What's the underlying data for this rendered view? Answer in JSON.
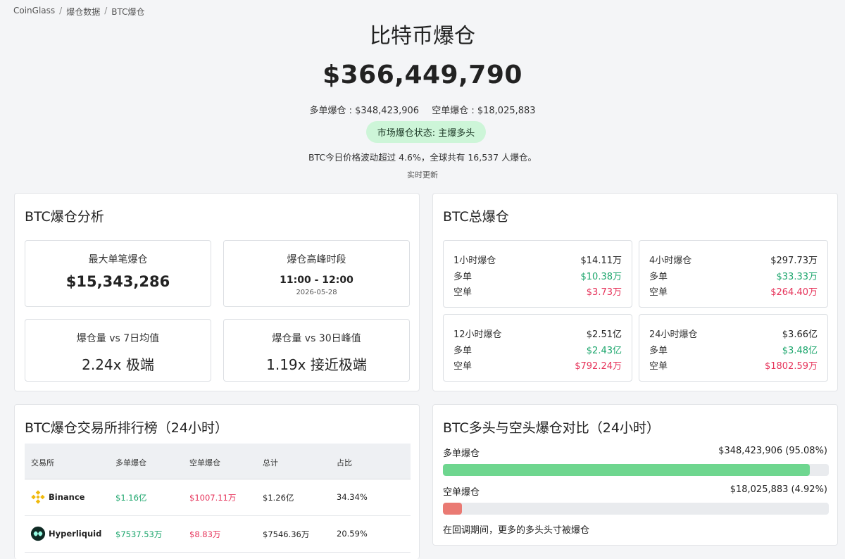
{
  "breadcrumb": [
    "CoinGlass",
    "爆仓数据",
    "BTC爆仓"
  ],
  "hero": {
    "title": "比特币爆仓",
    "amount": "$366,449,790",
    "long_text": "多单爆仓 : $348,423,906",
    "short_text": "空单爆仓 : $18,025,883",
    "status": "市场爆仓状态: 主爆多头",
    "desc": "BTC今日价格波动超过 4.6%，全球共有 16,537 人爆仓。",
    "live": "实时更新"
  },
  "analysis": {
    "title": "BTC爆仓分析",
    "max_label": "最大单笔爆仓",
    "max_value": "$15,343,286",
    "peak_label": "爆仓高峰时段",
    "peak_value": "11:00 - 12:00",
    "peak_date": "2026-05-28",
    "vs7_label": "爆仓量 vs 7日均值",
    "vs7_value": "2.24x 极端",
    "vs30_label": "爆仓量 vs 30日峰值",
    "vs30_value": "1.19x 接近极端"
  },
  "total": {
    "title": "BTC总爆仓",
    "long_label": "多单",
    "short_label": "空单",
    "boxes": [
      {
        "label": "1小时爆仓",
        "total": "$14.11万",
        "long": "$10.38万",
        "short": "$3.73万"
      },
      {
        "label": "4小时爆仓",
        "total": "$297.73万",
        "long": "$33.33万",
        "short": "$264.40万"
      },
      {
        "label": "12小时爆仓",
        "total": "$2.51亿",
        "long": "$2.43亿",
        "short": "$792.24万"
      },
      {
        "label": "24小时爆仓",
        "total": "$3.66亿",
        "long": "$3.48亿",
        "short": "$1802.59万"
      }
    ]
  },
  "ranking": {
    "title": "BTC爆仓交易所排行榜（24小时）",
    "headers": [
      "交易所",
      "多单爆仓",
      "空单爆仓",
      "总计",
      "占比"
    ],
    "rows": [
      {
        "exchange": "Binance",
        "long": "$1.16亿",
        "short": "$1007.11万",
        "total": "$1.26亿",
        "share": "34.34%",
        "logo": "binance-logo"
      },
      {
        "exchange": "Hyperliquid",
        "long": "$7537.53万",
        "short": "$8.83万",
        "total": "$7546.36万",
        "share": "20.59%",
        "logo": "hyperliquid-logo"
      }
    ]
  },
  "compare": {
    "title": "BTC多头与空头爆仓对比（24小时）",
    "long_label": "多单爆仓",
    "long_value": "$348,423,906 (95.08%)",
    "long_pct": 95.08,
    "long_color": "#6ed68f",
    "short_label": "空单爆仓",
    "short_value": "$18,025,883 (4.92%)",
    "short_pct": 4.92,
    "short_color": "#ea7a73",
    "note": "在回调期间，更多的多头头寸被爆仓"
  }
}
